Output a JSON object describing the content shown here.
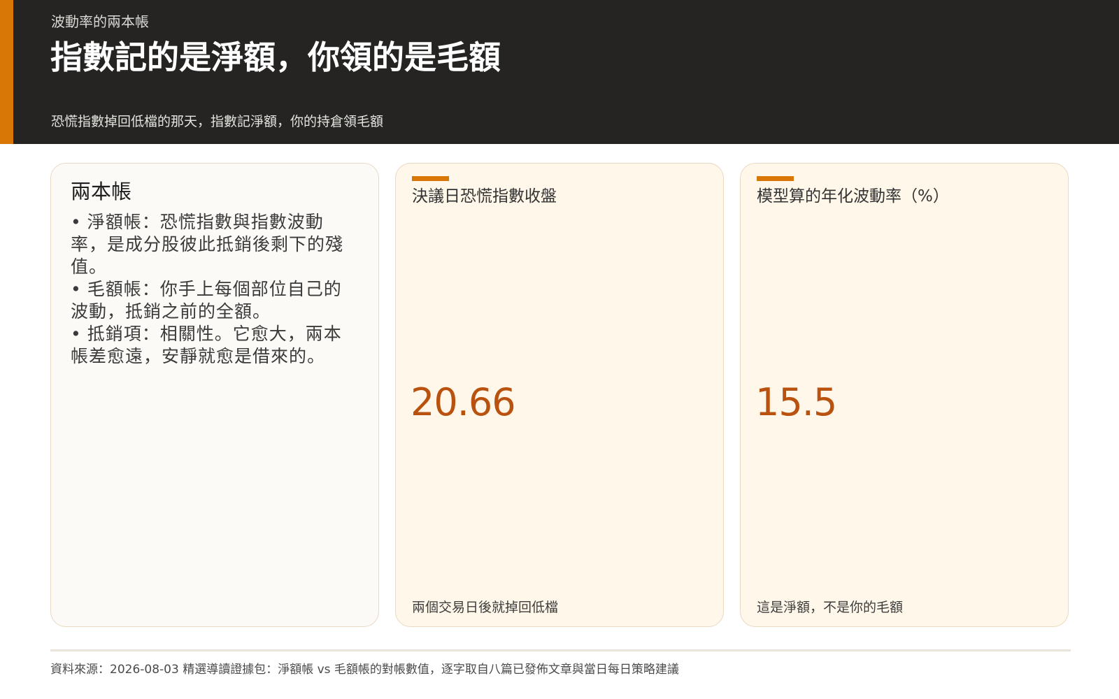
{
  "header": {
    "kicker": "波動率的兩本帳",
    "title": "指數記的是淨額，你領的是毛額",
    "subtitle": "恐慌指數掉回低檔的那天，指數記淨額，你的持倉領毛額"
  },
  "left_card": {
    "title": "兩本帳",
    "bullets": [
      "淨額帳：恐慌指數與指數波動率，是成分股彼此抵銷後剩下的殘值。",
      "毛額帳：你手上每個部位自己的波動，抵銷之前的全額。",
      "抵銷項：相關性。它愈大，兩本帳差愈遠，安靜就愈是借來的。"
    ]
  },
  "metrics": [
    {
      "label": "決議日恐慌指數收盤",
      "value": "20.66",
      "note": "兩個交易日後就掉回低檔"
    },
    {
      "label": "模型算的年化波動率（%）",
      "value": "15.5",
      "note": "這是淨額，不是你的毛額"
    }
  ],
  "footer": {
    "source": "資料來源：2026-08-03 精選導讀證據包：淨額帳 vs 毛額帳的對帳數值，逐字取自八篇已發佈文章與當日每日策略建議"
  },
  "colors": {
    "header_bg": "#252422",
    "accent": "#d97706",
    "value_color": "#b9520e",
    "card_bg": "#fff7e9"
  }
}
